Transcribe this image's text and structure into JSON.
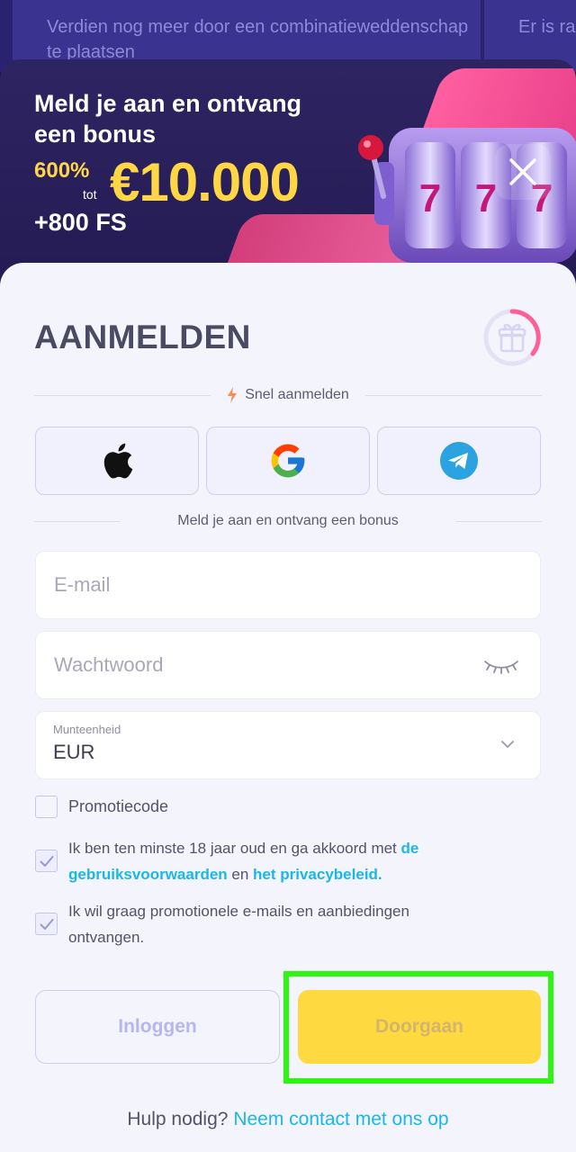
{
  "backdrop": {
    "promo_text_left": "Verdien nog meer door een combinatieweddenschap te plaatsen",
    "promo_text_right": "Er is rakel"
  },
  "banner": {
    "title": "Meld je aan en ontvang een bonus",
    "bonus_percent": "600%",
    "bonus_to": "tot",
    "bonus_amount": "€10.000",
    "free_spins": "+800 FS"
  },
  "form": {
    "title": "AANMELDEN",
    "quick_signup_label": "Snel aanmelden",
    "social": [
      {
        "name": "apple-icon"
      },
      {
        "name": "google-icon"
      },
      {
        "name": "telegram-icon"
      }
    ],
    "bonus_divider_label": "Meld je aan en ontvang een bonus",
    "email": {
      "placeholder": "E-mail",
      "value": ""
    },
    "password": {
      "placeholder": "Wachtwoord",
      "value": ""
    },
    "currency": {
      "label": "Munteenheid",
      "value": "EUR"
    },
    "promo_code": {
      "label": "Promotiecode",
      "checked": false
    },
    "terms": {
      "checked": true,
      "text_before": "Ik ben ten minste 18 jaar oud en ga akkoord met ",
      "link_terms": "de gebruiksvoorwaarden",
      "text_middle": " en ",
      "link_privacy": "het privacybeleid."
    },
    "marketing": {
      "checked": true,
      "text": "Ik wil graag promotionele e-mails en aanbiedingen ontvangen."
    },
    "login_button": "Inloggen",
    "continue_button": "Doorgaan",
    "help_text": "Hulp nodig?",
    "help_link": "Neem contact met ons op"
  },
  "colors": {
    "accent_yellow": "#ffd940",
    "link_blue": "#1ab7ea",
    "highlight_green": "#2ff512",
    "banner_bg": "#2e2462"
  }
}
